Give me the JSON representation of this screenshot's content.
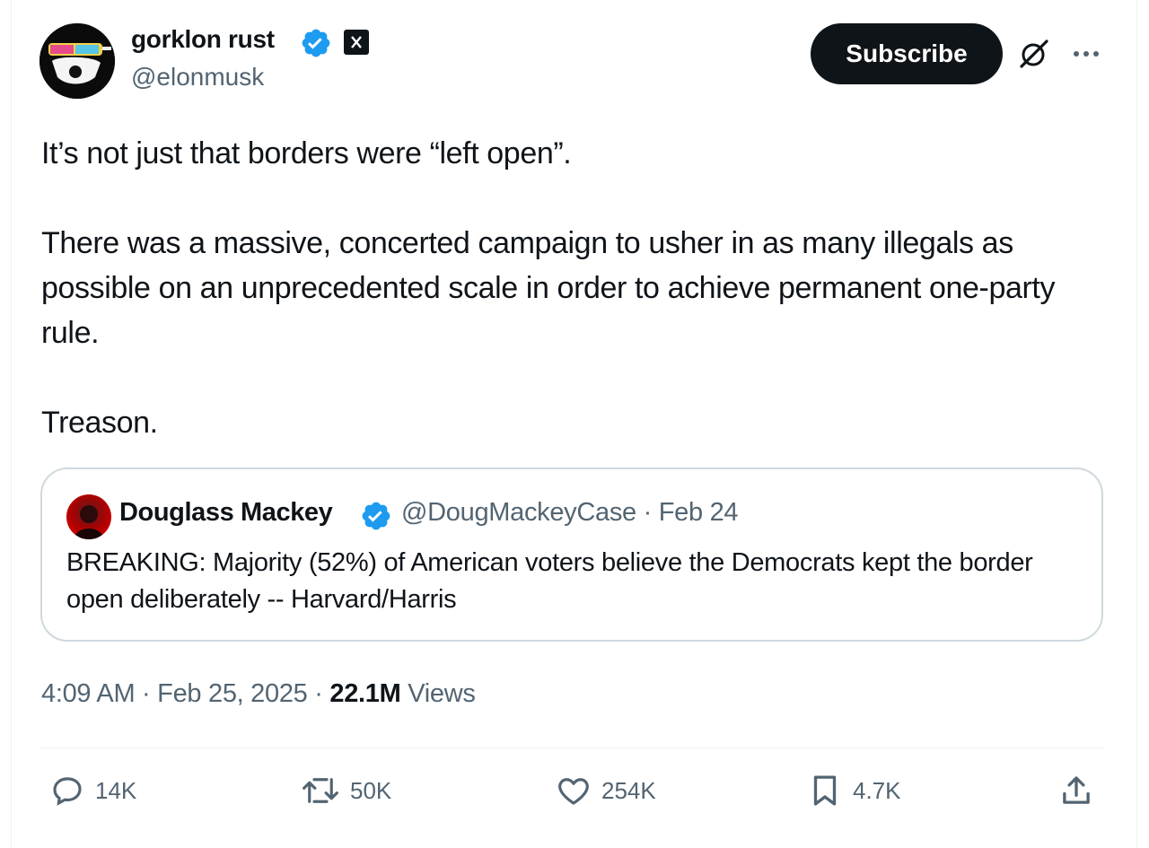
{
  "author": {
    "display_name": "gorklon rust",
    "handle": "@elonmusk",
    "verified_icon": "verified-badge-icon",
    "affiliation_icon": "x-affiliate-icon"
  },
  "header": {
    "subscribe_label": "Subscribe",
    "grok_icon": "grok-icon",
    "more_icon": "more-icon"
  },
  "post": {
    "paragraphs": [
      "It’s not just that borders were “left open”.",
      "There was a massive, concerted campaign to usher in as many illegals as possible on an unprecedented scale in order to achieve permanent one-party rule.",
      "Treason."
    ]
  },
  "quote": {
    "display_name": "Douglass Mackey",
    "meta": "@DougMackeyCase · Feb 24",
    "text": "BREAKING: Majority (52%) of American voters believe the Democrats kept the border open deliberately -- Harvard/Harris"
  },
  "meta": {
    "time_date": "4:09 AM · Feb 25, 2025 · ",
    "views_count": "22.1M",
    "views_label": " Views"
  },
  "actions": {
    "replies": "14K",
    "reposts": "50K",
    "likes": "254K",
    "bookmarks": "4.7K"
  },
  "colors": {
    "text": "#0f1419",
    "secondary": "#536471",
    "verified": "#1d9bf0",
    "border": "#cfd9de"
  }
}
